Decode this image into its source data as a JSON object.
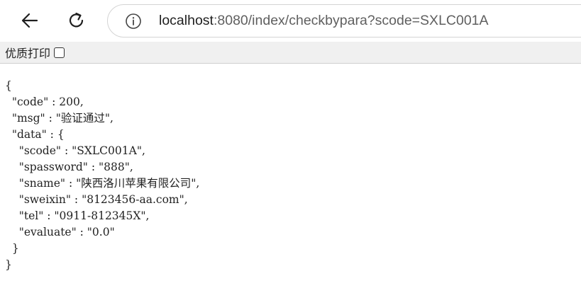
{
  "browser": {
    "url_host": "localhost",
    "url_rest": ":8080/index/checkbypara?scode=SXLC001A",
    "back_icon": "back-arrow-icon",
    "reload_icon": "reload-icon",
    "info_icon": "info-icon"
  },
  "print_bar": {
    "label": "优质打印",
    "checked": false
  },
  "json_lines": [
    "{",
    "  \"code\" : 200,",
    "  \"msg\" : \"验证通过\",",
    "  \"data\" : {",
    "    \"scode\" : \"SXLC001A\",",
    "    \"spassword\" : \"888\",",
    "    \"sname\" : \"陕西洛川苹果有限公司\",",
    "    \"sweixin\" : \"8123456-aa.com\",",
    "    \"tel\" : \"0911-812345X\",",
    "    \"evaluate\" : \"0.0\"",
    "  }",
    "}"
  ]
}
